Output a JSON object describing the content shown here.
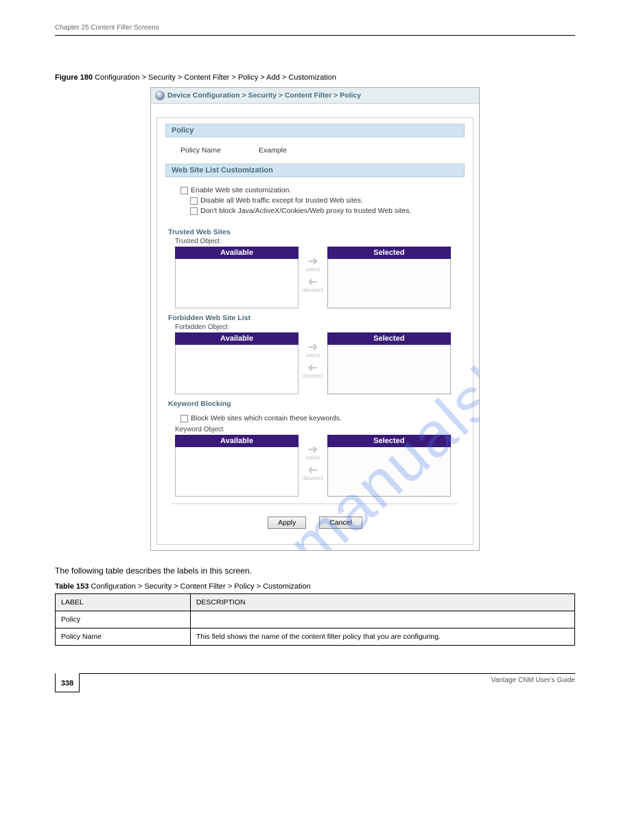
{
  "header_chapter": "Chapter 25 Content Filter Screens",
  "figure_label_prefix": "Figure 180   ",
  "figure_label": "Configuration > Security > Content Filter > Policy > Add > Customization",
  "breadcrumb": "Device Configuration > Security > Content Filter > Policy",
  "sections": {
    "policy": {
      "header": "Policy",
      "name_label": "Policy Name",
      "name_value": "Example"
    },
    "customization": {
      "header": "Web Site List Customization",
      "enable": "Enable Web site customization.",
      "disable_traffic": "Disable all Web traffic except for trusted Web sites.",
      "dont_block": "Don't block Java/ActiveX/Cookies/Web proxy to trusted Web sites."
    },
    "trusted": {
      "header": "Trusted Web Sites",
      "object_label": "Trusted Object"
    },
    "forbidden": {
      "header": "Forbidden Web Site List",
      "object_label": "Forbidden Object"
    },
    "keyword": {
      "header": "Keyword Blocking",
      "block_label": "Block Web sites which contain these keywords.",
      "object_label": "Keyword Object"
    }
  },
  "picker": {
    "available": "Available",
    "selected": "Selected",
    "select_label": "select",
    "deselect_label": "deselect"
  },
  "buttons": {
    "apply": "Apply",
    "cancel": "Cancel"
  },
  "desc_para": "The following table describes the labels in this screen.",
  "table_caption_prefix": "Table 153   ",
  "table_caption": "Configuration > Security > Content Filter > Policy > Customization",
  "table": {
    "col1": "LABEL",
    "col2": "DESCRIPTION",
    "rows": [
      {
        "label": "Policy",
        "desc": ""
      },
      {
        "label": "Policy Name",
        "desc": "This field shows the name of the content filter policy that you are configuring."
      }
    ]
  },
  "page_number": "338",
  "footer_text": "Vantage CNM User's Guide",
  "watermark": "manualshive.com"
}
